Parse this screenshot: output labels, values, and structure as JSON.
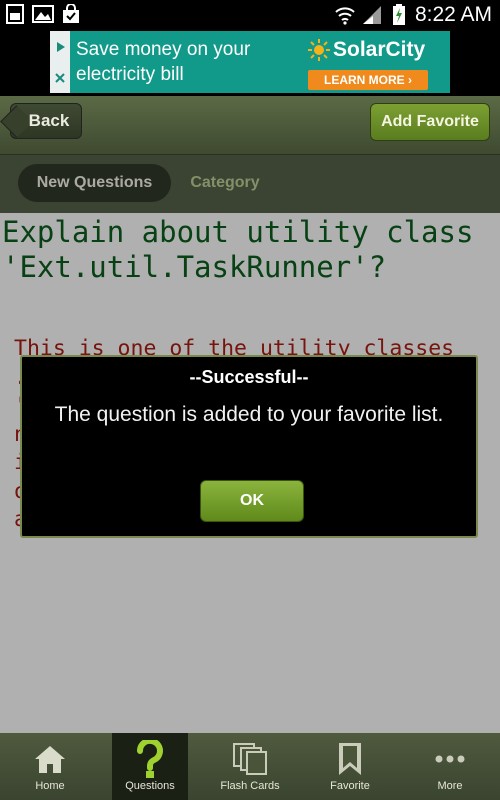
{
  "status_bar": {
    "time": "8:22 AM",
    "icons": [
      "sim-card-icon",
      "image-icon",
      "bag-check-icon",
      "wifi-icon",
      "signal-icon",
      "battery-charging-icon"
    ]
  },
  "ad": {
    "line1": "Save money on your",
    "line2": "electricity bill",
    "brand": "SolarCity",
    "cta": "LEARN MORE ›"
  },
  "toolbar": {
    "back_label": "Back",
    "favorite_label": "Add Favorite"
  },
  "tabs": [
    {
      "label": "New Questions",
      "active": true
    },
    {
      "label": "Category",
      "active": false
    }
  ],
  "question": {
    "title": "Explain about utility class 'Ext.util.TaskRunner'?",
    "answer": "This is one of the utility classes ... you can use the singleton 'Ext.TaskManager' instead, but if needed, you can create separate instances of TaskRunner. Any number of separate tasks can be started at any time and will run"
  },
  "dialog": {
    "title": "--Successful--",
    "message": "The question is added to your favorite list.",
    "ok_label": "OK"
  },
  "bottom_nav": [
    {
      "label": "Home",
      "icon": "home-icon",
      "active": false
    },
    {
      "label": "Questions",
      "icon": "question-mark-icon",
      "active": true
    },
    {
      "label": "Flash Cards",
      "icon": "flash-cards-icon",
      "active": false
    },
    {
      "label": "Favorite",
      "icon": "bookmark-icon",
      "active": false
    },
    {
      "label": "More",
      "icon": "more-dots-icon",
      "active": false
    }
  ],
  "colors": {
    "question_green": "#0b5a1c",
    "answer_red": "#a61c12",
    "toolbar_olive": "#4f5a3e",
    "accent_green": "#6f9a27"
  }
}
